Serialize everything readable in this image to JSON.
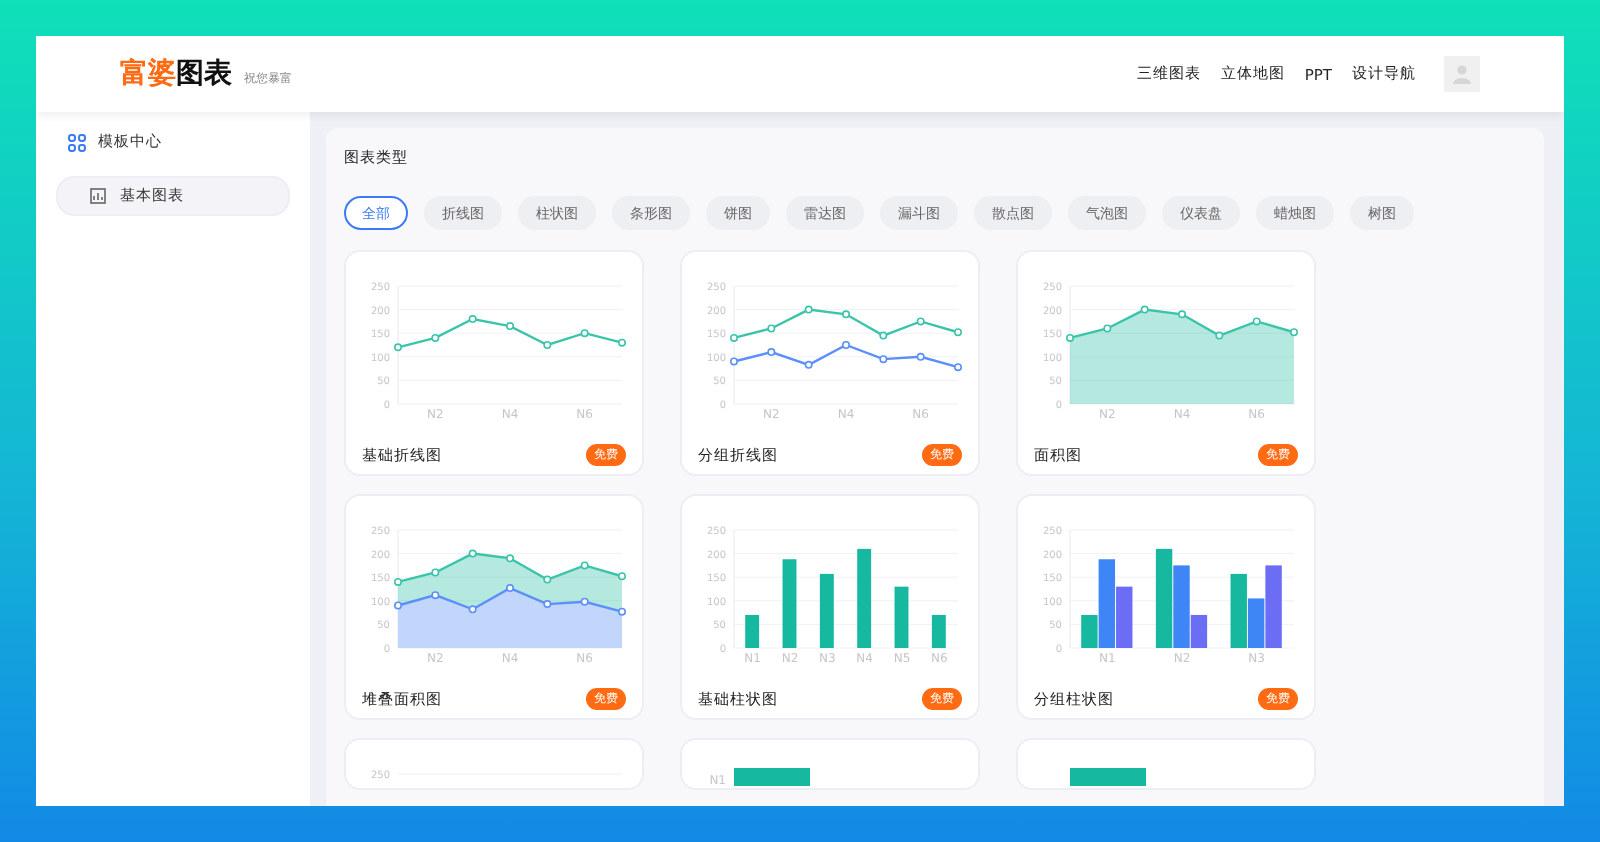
{
  "header": {
    "brand_accent": "富婆",
    "brand_main": "图表",
    "slogan": "祝您暴富",
    "nav": [
      "三维图表",
      "立体地图",
      "PPT",
      "设计导航"
    ]
  },
  "sidebar": {
    "title": "模板中心",
    "items": [
      {
        "label": "基本图表",
        "selected": true
      }
    ]
  },
  "section_title": "图表类型",
  "tabs": [
    {
      "label": "全部",
      "selected": true
    },
    {
      "label": "折线图",
      "selected": false
    },
    {
      "label": "柱状图",
      "selected": false
    },
    {
      "label": "条形图",
      "selected": false
    },
    {
      "label": "饼图",
      "selected": false
    },
    {
      "label": "雷达图",
      "selected": false
    },
    {
      "label": "漏斗图",
      "selected": false
    },
    {
      "label": "散点图",
      "selected": false
    },
    {
      "label": "气泡图",
      "selected": false
    },
    {
      "label": "仪表盘",
      "selected": false
    },
    {
      "label": "蜡烛图",
      "selected": false
    },
    {
      "label": "树图",
      "selected": false
    }
  ],
  "cards": [
    {
      "title": "基础折线图",
      "badge": "免费",
      "chart_data": {
        "type": "line",
        "grid": true,
        "categories": [
          null,
          "N2",
          null,
          "N4",
          null,
          "N6",
          null
        ],
        "yticks": [
          0,
          50,
          100,
          150,
          200,
          250
        ],
        "ylim": [
          0,
          250
        ],
        "series": [
          {
            "color": "#3cc4ab",
            "marker": true,
            "values": [
              120,
              140,
              180,
              165,
              125,
              150,
              130
            ]
          }
        ]
      }
    },
    {
      "title": "分组折线图",
      "badge": "免费",
      "chart_data": {
        "type": "line",
        "grid": true,
        "categories": [
          null,
          "N2",
          null,
          "N4",
          null,
          "N6",
          null
        ],
        "yticks": [
          0,
          50,
          100,
          150,
          200,
          250
        ],
        "ylim": [
          0,
          250
        ],
        "series": [
          {
            "color": "#3cc4ab",
            "marker": true,
            "values": [
              140,
              160,
              200,
              190,
              145,
              175,
              152
            ]
          },
          {
            "color": "#5b8ff9",
            "marker": true,
            "values": [
              90,
              110,
              83,
              125,
              95,
              100,
              78
            ]
          }
        ]
      }
    },
    {
      "title": "面积图",
      "badge": "免费",
      "chart_data": {
        "type": "area",
        "grid": true,
        "categories": [
          null,
          "N2",
          null,
          "N4",
          null,
          "N6",
          null
        ],
        "yticks": [
          0,
          50,
          100,
          150,
          200,
          250
        ],
        "ylim": [
          0,
          250
        ],
        "series": [
          {
            "color": "#3cc4ab",
            "marker": true,
            "values": [
              140,
              160,
              200,
              190,
              145,
              175,
              152
            ]
          }
        ]
      }
    },
    {
      "title": "堆叠面积图",
      "badge": "免费",
      "chart_data": {
        "type": "area",
        "grid": true,
        "categories": [
          null,
          "N2",
          null,
          "N4",
          null,
          "N6",
          null
        ],
        "yticks": [
          0,
          50,
          100,
          150,
          200,
          250
        ],
        "ylim": [
          0,
          250
        ],
        "series": [
          {
            "color": "#3cc4ab",
            "marker": true,
            "values": [
              140,
              160,
              200,
              190,
              145,
              175,
              152
            ]
          },
          {
            "color": "#5b8ff9",
            "marker": true,
            "values": [
              90,
              112,
              82,
              127,
              93,
              98,
              77
            ]
          }
        ]
      }
    },
    {
      "title": "基础柱状图",
      "badge": "免费",
      "chart_data": {
        "type": "bar",
        "grid": true,
        "categories": [
          "N1",
          "N2",
          "N3",
          "N4",
          "N5",
          "N6"
        ],
        "yticks": [
          0,
          50,
          100,
          150,
          200,
          250
        ],
        "ylim": [
          0,
          250
        ],
        "series": [
          {
            "color": "#16b9a0",
            "values": [
              70,
              188,
              157,
              210,
              130,
              70
            ]
          }
        ]
      }
    },
    {
      "title": "分组柱状图",
      "badge": "免费",
      "chart_data": {
        "type": "bar",
        "grid": true,
        "categories": [
          "N1",
          "N2",
          "N3"
        ],
        "yticks": [
          0,
          50,
          100,
          150,
          200,
          250
        ],
        "ylim": [
          0,
          250
        ],
        "series": [
          {
            "color": "#16b9a0",
            "values": [
              70,
              210,
              157
            ]
          },
          {
            "color": "#3e86f5",
            "values": [
              188,
              175,
              105
            ]
          },
          {
            "color": "#6b6ef5",
            "values": [
              130,
              70,
              175
            ]
          }
        ]
      }
    }
  ],
  "partial_cards": [
    {
      "kind": "axis",
      "label": "250"
    },
    {
      "kind": "hbar",
      "label": "N1"
    },
    {
      "kind": "hbar"
    }
  ]
}
